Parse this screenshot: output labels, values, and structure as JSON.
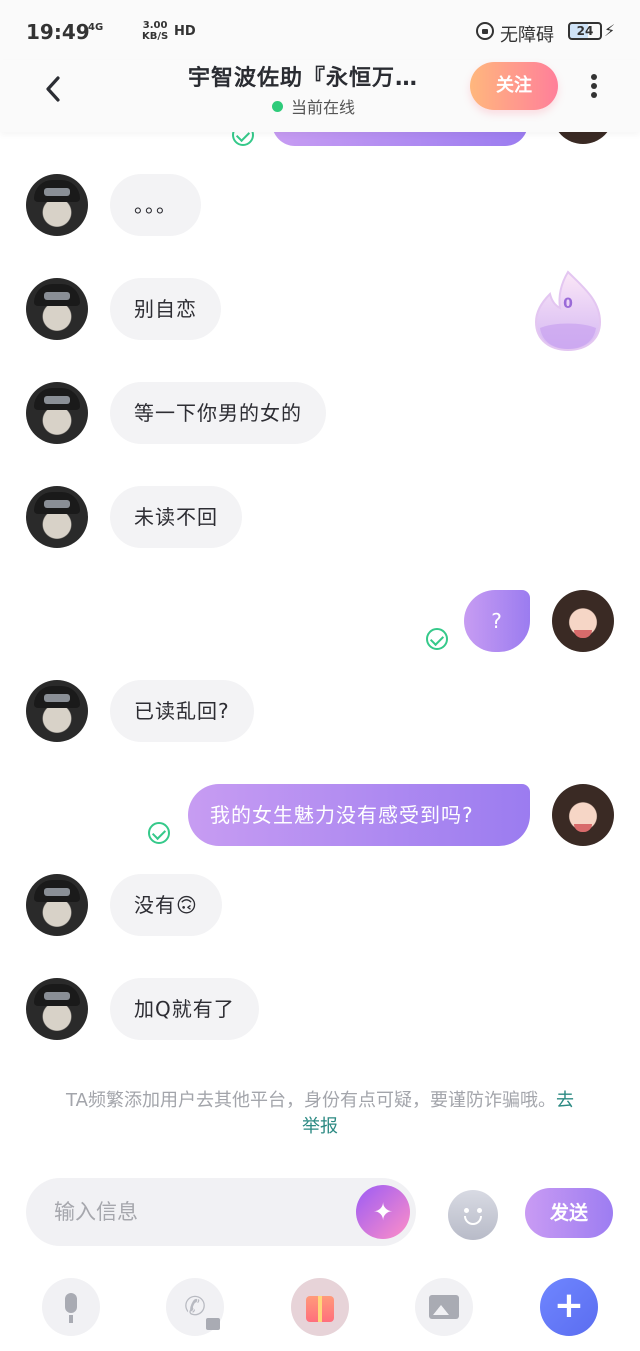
{
  "status_bar": {
    "time": "19:49",
    "network": "4G",
    "speed_value": "3.00",
    "speed_unit": "KB/S",
    "hd": "HD",
    "accessibility": "无障碍",
    "battery": "24"
  },
  "header": {
    "title": "宇智波佐助『永恒万…",
    "online_status": "当前在线",
    "follow_label": "关注"
  },
  "flame_count": "0",
  "messages": [
    {
      "side": "in",
      "text": "。。。"
    },
    {
      "side": "in",
      "text": "别自恋"
    },
    {
      "side": "in",
      "text": "等一下你男的女的"
    },
    {
      "side": "in",
      "text": "未读不回"
    },
    {
      "side": "out",
      "text": "?"
    },
    {
      "side": "in",
      "text": "已读乱回?"
    },
    {
      "side": "out",
      "text": "我的女生魅力没有感受到吗?"
    },
    {
      "side": "in",
      "text": "没有🙃"
    },
    {
      "side": "in",
      "text": "加Q就有了"
    }
  ],
  "warning": {
    "text": "TA频繁添加用户去其他平台，身份有点可疑，要谨防诈骗哦。",
    "link": "去举报"
  },
  "input": {
    "placeholder": "输入信息",
    "send_label": "发送"
  },
  "colors": {
    "accent_purple": "#9b7cf0",
    "follow_gradient_start": "#ffb77d",
    "follow_gradient_end": "#ff7f9a",
    "online_green": "#2ecb7a",
    "link_teal": "#2c8a83"
  }
}
